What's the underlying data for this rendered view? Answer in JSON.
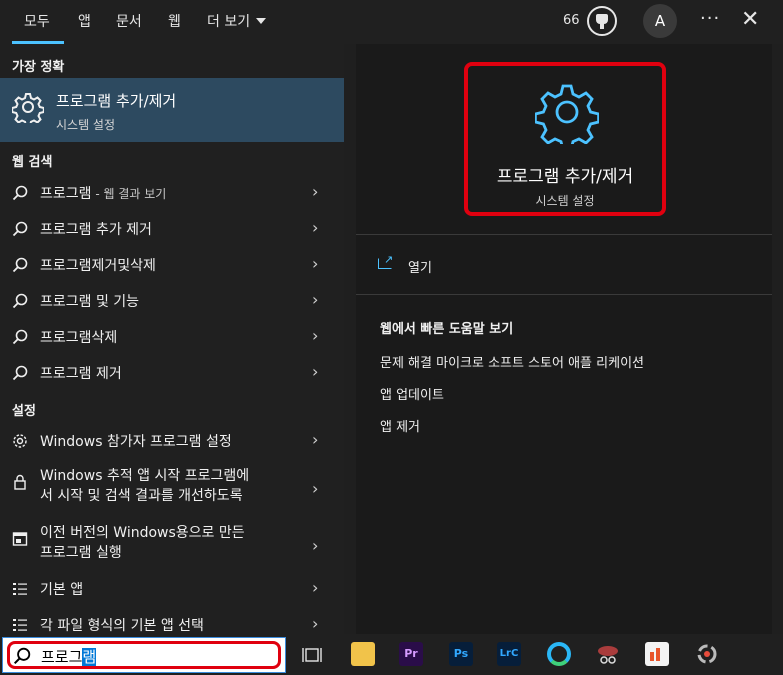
{
  "tabs": [
    {
      "label": "모두",
      "active": true
    },
    {
      "label": "앱"
    },
    {
      "label": "문서"
    },
    {
      "label": "웹"
    },
    {
      "label": "더 보기"
    }
  ],
  "header": {
    "points": "66",
    "avatar_initial": "A",
    "more": "···",
    "close": "✕"
  },
  "left": {
    "best_match_heading": "가장 정확",
    "best_match": {
      "title": "프로그램 추가/제거",
      "subtitle": "시스템 설정"
    },
    "web_heading": "웹 검색",
    "web_items": [
      {
        "label": "프로그램",
        "suffix": " - 웹 결과 보기"
      },
      {
        "label": "프로그램 추가 제거"
      },
      {
        "label": "프로그램제거및삭제"
      },
      {
        "label": "프로그램 및 기능"
      },
      {
        "label": "프로그램삭제"
      },
      {
        "label": "프로그램 제거"
      }
    ],
    "settings_heading": "설정",
    "settings_items": [
      {
        "line1": "Windows 참가자 프로그램 설정"
      },
      {
        "line1": "Windows 추적 앱 시작 프로그램에",
        "line2": "서 시작 및 검색 결과를 개선하도록"
      },
      {
        "line1": "이전 버전의 Windows용으로 만든",
        "line2": "프로그램 실행"
      },
      {
        "line1": "기본 앱"
      },
      {
        "line1": "각 파일 형식의 기본 앱 선택"
      }
    ]
  },
  "right": {
    "title": "프로그램 추가/제거",
    "subtitle": "시스템 설정",
    "open_label": "열기",
    "web_help_heading": "웹에서 빠른 도움말 보기",
    "web_links": [
      "문제 해결 마이크로 소프트 스토어 애플 리케이션",
      "앱 업데이트",
      "앱 제거"
    ]
  },
  "taskbar": {
    "search_typed": "프로그",
    "search_selected": "램",
    "apps": [
      "file-explorer",
      "premiere-pro",
      "photoshop",
      "lightroom-classic",
      "edge",
      "snipping-tool",
      "office",
      "other-app"
    ],
    "app_labels": {
      "premiere": "Pr",
      "photoshop": "Ps",
      "lightroom": "LrC"
    }
  },
  "colors": {
    "accent": "#4cc2ff",
    "highlight": "#e0000f",
    "selected_row": "#2d4a60"
  }
}
